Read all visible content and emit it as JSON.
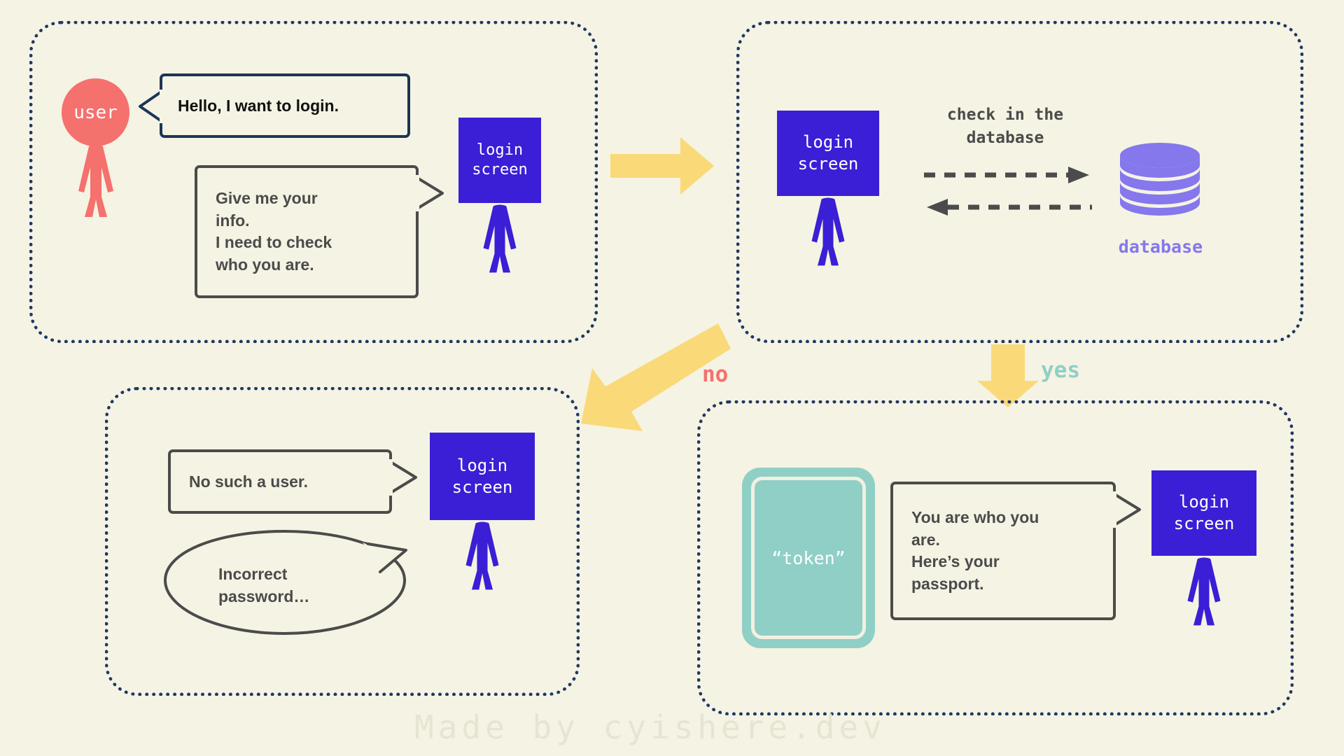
{
  "canvas": {
    "background": "#f5f3e3",
    "panel_border_color": "#1f3864",
    "accent_blue": "#3a1fd6",
    "accent_coral": "#f4716e",
    "accent_yellow": "#fad978",
    "accent_teal": "#8fcfc6",
    "accent_purple": "#8577ec",
    "text_gray": "#4b4b4b",
    "text_navy": "#1c3557"
  },
  "watermark": {
    "text": "Made by cyishere.dev"
  },
  "panel1": {
    "user": {
      "label": "user"
    },
    "bubble_hello": {
      "text": "Hello, I want to login."
    },
    "bubble_give_info": {
      "text": "Give me your\ninfo.\nI need to check\nwho you are."
    },
    "login_screen": {
      "line1": "login",
      "line2": "screen"
    }
  },
  "panel2": {
    "login_screen": {
      "line1": "login",
      "line2": "screen"
    },
    "check_label": {
      "line1": "check in the",
      "line2": "database"
    },
    "database": {
      "label": "database"
    }
  },
  "panel3": {
    "bubble_no_user": {
      "text": "No such a user."
    },
    "bubble_incorrect": {
      "text": "Incorrect\npassword…"
    },
    "login_screen": {
      "line1": "login",
      "line2": "screen"
    }
  },
  "panel4": {
    "token": {
      "label": "“token”"
    },
    "bubble_passport": {
      "text": "You are who you\nare.\nHere’s your\npassport."
    },
    "login_screen": {
      "line1": "login",
      "line2": "screen"
    }
  },
  "flow": {
    "arrow_right": "flow-arrow-right",
    "arrow_diagonal": "flow-arrow-diagonal",
    "arrow_down": "flow-arrow-down",
    "label_no": "no",
    "label_yes": "yes"
  }
}
